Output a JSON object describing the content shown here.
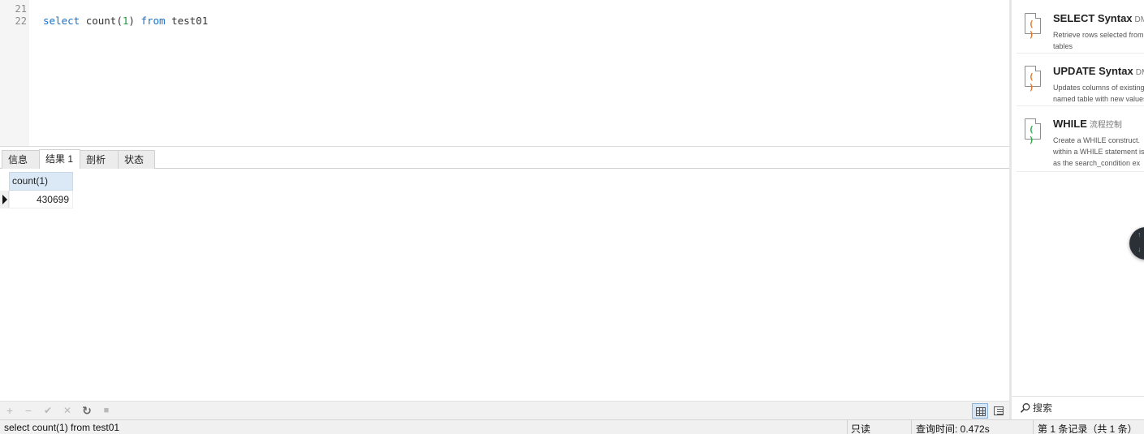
{
  "editor": {
    "line_numbers": [
      "21",
      "22"
    ],
    "code": {
      "kw_select": "select",
      "fn_count": "count(",
      "num_arg": "1",
      "paren_close": ")",
      "kw_from": "from",
      "table": "test01"
    }
  },
  "result_tabs": [
    {
      "label": "信息"
    },
    {
      "label": "结果 1"
    },
    {
      "label": "剖析"
    },
    {
      "label": "状态"
    }
  ],
  "grid": {
    "columns": [
      "count(1)"
    ],
    "rows": [
      [
        "430699"
      ]
    ]
  },
  "toolbar": {
    "add": "+",
    "remove": "−",
    "apply": "✔",
    "discard": "✕",
    "refresh": "↻",
    "stop": "■"
  },
  "statusbar": {
    "sql": "select count(1) from test01",
    "mode": "只读",
    "query_time": "查询时间: 0.472s",
    "record_info": "第 1 条记录（共 1 条）"
  },
  "snippets": [
    {
      "title": "SELECT Syntax",
      "tag": "DML",
      "desc1": "Retrieve rows selected from",
      "desc2": "tables",
      "icon_color": "#e07a2e"
    },
    {
      "title": "UPDATE Syntax",
      "tag": "DML",
      "desc1": "Updates columns of existing",
      "desc2": "named table with new values",
      "icon_color": "#e07a2e"
    },
    {
      "title": "WHILE",
      "tag": "流程控制",
      "desc1": "Create a WHILE construct.",
      "desc2": "within a WHILE statement is",
      "desc3": "as the search_condition ex",
      "icon_color": "#2eaa4a"
    }
  ],
  "side_search": {
    "placeholder": "搜索"
  }
}
